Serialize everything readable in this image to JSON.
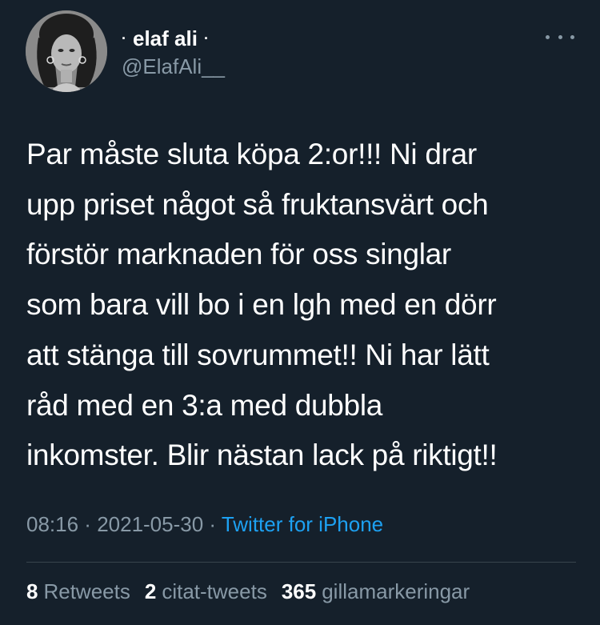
{
  "user": {
    "display_name": "elaf ali",
    "name_decoration": "·",
    "handle": "@ElafAli__"
  },
  "icons": {
    "more": "more-horizontal-icon",
    "avatar": "profile-avatar-image"
  },
  "tweet": {
    "lines": [
      "Par måste sluta köpa 2:or!!! Ni drar",
      "upp priset något så fruktansvärt och",
      "förstör marknaden för oss singlar",
      "som bara vill bo i en lgh med en dörr",
      "att stänga till sovrummet!! Ni har lätt",
      "råd med en 3:a med dubbla",
      "inkomster. Blir nästan lack på riktigt!!"
    ]
  },
  "meta": {
    "time": "08:16",
    "separator": " · ",
    "date": "2021-05-30",
    "source": "Twitter for iPhone"
  },
  "stats": {
    "retweets_count": "8",
    "retweets_label": "Retweets",
    "quotes_count": "2",
    "quotes_label": "citat-tweets",
    "likes_count": "365",
    "likes_label": "gillamarkeringar"
  },
  "colors": {
    "background": "#15202b",
    "secondary_text": "#8899a6",
    "link": "#1da1f2",
    "divider": "#38444d"
  }
}
